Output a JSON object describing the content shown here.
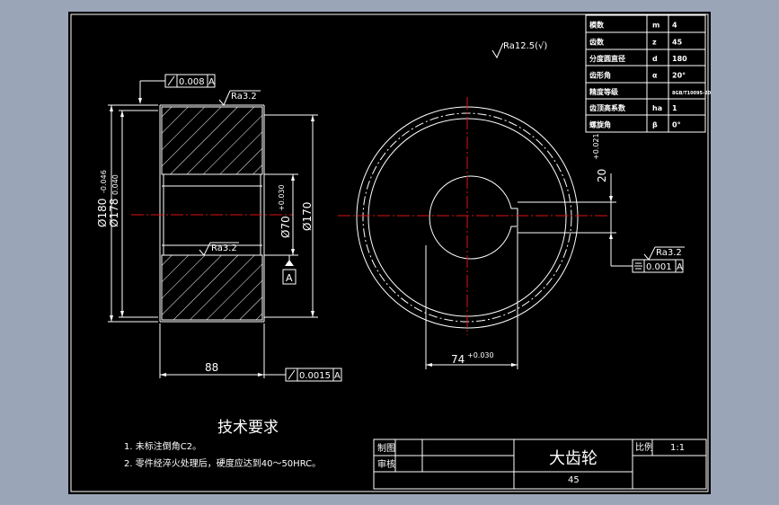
{
  "param_table": [
    {
      "name": "模数",
      "sym": "m",
      "val": "4"
    },
    {
      "name": "齿数",
      "sym": "z",
      "val": "45"
    },
    {
      "name": "分度圆直径",
      "sym": "d",
      "val": "180"
    },
    {
      "name": "齿形角",
      "sym": "α",
      "val": "20°"
    },
    {
      "name": "精度等级",
      "sym": "",
      "val": "8GB/T10095-2008"
    },
    {
      "name": "齿顶高系数",
      "sym": "ha",
      "val": "1"
    },
    {
      "name": "螺旋角",
      "sym": "β",
      "val": "0°"
    }
  ],
  "left_view": {
    "d_outer": "Ø180",
    "d_outer_tol": "-0.046",
    "d_second": "Ø178",
    "d_second_tol": "0.040",
    "d_bore": "Ø70",
    "d_bore_tol": "+0.030",
    "d_hub": "Ø170",
    "width": "88",
    "runout_top": "0.008",
    "runout_bottom": "0.0015",
    "datum_ref": "A",
    "datum_label": "A",
    "roughness_top": "Ra3.2",
    "roughness_bore": "Ra3.2"
  },
  "right_view": {
    "keyway_width": "20",
    "keyway_tol": "+0.021",
    "keyway_depth": "74",
    "keyway_depth_tol": "+0.030",
    "roughness_key": "Ra3.2",
    "symmetry_tol": "0.001",
    "symmetry_ref": "A"
  },
  "general_roughness": "Ra12.5(√)",
  "tech_req": {
    "title": "技术要求",
    "items": [
      "1. 未标注倒角C2。",
      "2. 零件经淬火处理后，硬度应达到40～50HRC。"
    ]
  },
  "title_block": {
    "drawn_label": "制图",
    "checked_label": "审核",
    "part_name": "大齿轮",
    "material": "45",
    "scale_label": "比例",
    "scale_value": "1:1"
  }
}
